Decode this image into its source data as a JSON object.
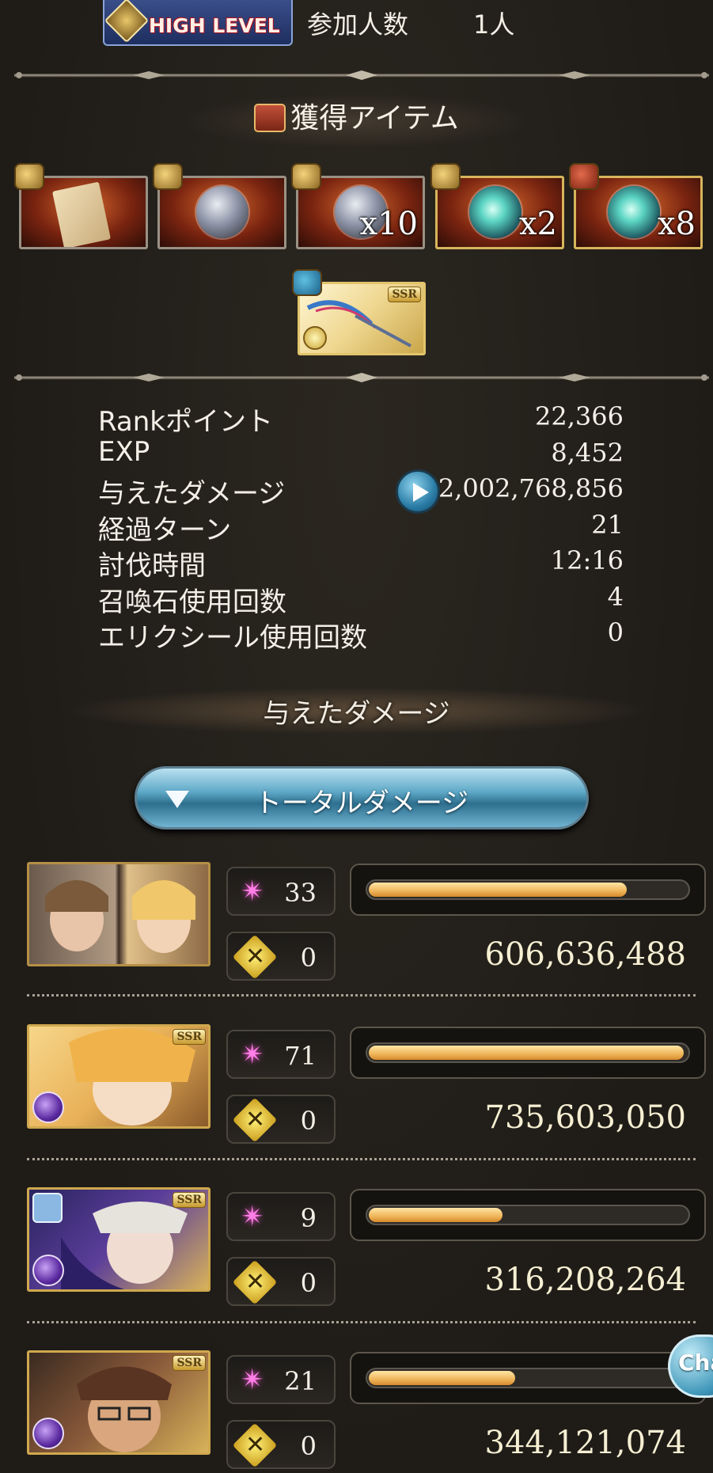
{
  "header": {
    "badge_text": "HIGH LEVEL",
    "participants_label": "参加人数",
    "participants_value": "1人"
  },
  "items_section": {
    "title": "獲得アイテム",
    "items": [
      {
        "name": "scroll",
        "qty": ""
      },
      {
        "name": "silver-orb",
        "qty": ""
      },
      {
        "name": "silver-orb",
        "qty": "x10"
      },
      {
        "name": "green-orb",
        "qty": "x2"
      },
      {
        "name": "green-orb",
        "qty": "x8"
      }
    ],
    "weapon_badge": "SSR"
  },
  "stats": [
    {
      "label": "Rankポイント",
      "value": "22,366"
    },
    {
      "label": "EXP",
      "value": "8,452"
    },
    {
      "label": "与えたダメージ",
      "value": "2,002,768,856"
    },
    {
      "label": "経過ターン",
      "value": "21"
    },
    {
      "label": "討伐時間",
      "value": "12:16"
    },
    {
      "label": "召喚石使用回数",
      "value": "4"
    },
    {
      "label": "エリクシール使用回数",
      "value": "0"
    }
  ],
  "damage_section": {
    "title": "与えたダメージ",
    "dropdown_label": "トータルダメージ"
  },
  "characters": [
    {
      "ssr": "",
      "skills": "33",
      "ougi": "0",
      "damage": "606,636,488",
      "bar_fraction": 0.81
    },
    {
      "ssr": "SSR",
      "skills": "71",
      "ougi": "0",
      "damage": "735,603,050",
      "bar_fraction": 0.99
    },
    {
      "ssr": "SSR",
      "skills": "9",
      "ougi": "0",
      "damage": "316,208,264",
      "bar_fraction": 0.42
    },
    {
      "ssr": "SSR",
      "skills": "21",
      "ougi": "0",
      "damage": "344,121,074",
      "bar_fraction": 0.46
    }
  ],
  "chat_button": "Cha",
  "colors": {
    "background": "#221f1a",
    "bar_fill": "#efb55a",
    "skill_star": "#ff7fe8",
    "accent_blue": "#5ea8c7"
  }
}
